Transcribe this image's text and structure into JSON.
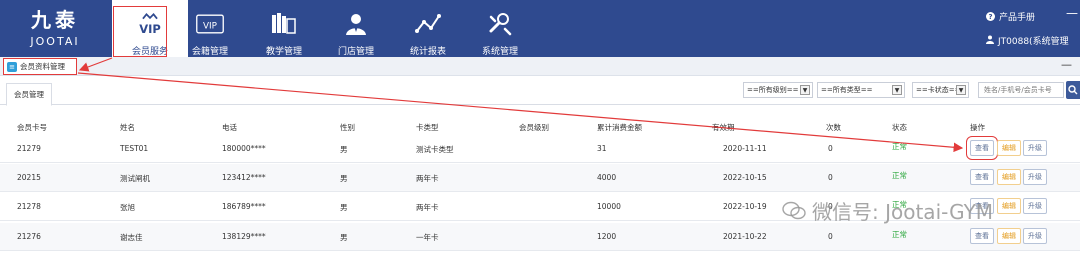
{
  "brand": {
    "cn": "九泰",
    "en": "JOOTAI"
  },
  "nav": [
    {
      "label": "会员服务",
      "icon": "vip-crown-icon",
      "vip_text": "VIP",
      "active": true
    },
    {
      "label": "会籍管理",
      "icon": "vip-card-icon",
      "vip_text": "VIP",
      "active": false
    },
    {
      "label": "教学管理",
      "icon": "books-icon",
      "active": false
    },
    {
      "label": "门店管理",
      "icon": "user-badge-icon",
      "active": false
    },
    {
      "label": "统计报表",
      "icon": "chart-line-icon",
      "active": false
    },
    {
      "label": "系统管理",
      "icon": "wrench-icon",
      "active": false
    }
  ],
  "top_right": {
    "manual": "产品手册",
    "user": "JT0088(系统管理",
    "dash": "—"
  },
  "breadcrumb": {
    "label": "会员资料管理",
    "collapse": "—"
  },
  "tabs": [
    {
      "label": "会员管理"
    }
  ],
  "filters": {
    "level": "==所有级别==",
    "type": "==所有类型==",
    "status": "==卡状态==",
    "search_placeholder": "姓名/手机号/会员卡号"
  },
  "table": {
    "headers": [
      "会员卡号",
      "姓名",
      "电话",
      "性别",
      "卡类型",
      "会员级别",
      "累计消费金额",
      "有效期",
      "次数",
      "状态",
      "操作"
    ],
    "rows": [
      {
        "card": "21279",
        "name": "TEST01",
        "phone": "180000****",
        "gender": "男",
        "card_type": "测试卡类型",
        "level": "",
        "total": "31",
        "expiry": "2020-11-11",
        "count": "0",
        "status": "正常"
      },
      {
        "card": "20215",
        "name": "测试闸机",
        "phone": "123412****",
        "gender": "男",
        "card_type": "两年卡",
        "level": "",
        "total": "4000",
        "expiry": "2022-10-15",
        "count": "0",
        "status": "正常"
      },
      {
        "card": "21278",
        "name": "张旭",
        "phone": "186789****",
        "gender": "男",
        "card_type": "两年卡",
        "level": "",
        "total": "10000",
        "expiry": "2022-10-19",
        "count": "0",
        "status": "正常"
      },
      {
        "card": "21276",
        "name": "谢志佳",
        "phone": "138129****",
        "gender": "男",
        "card_type": "一年卡",
        "level": "",
        "total": "1200",
        "expiry": "2021-10-22",
        "count": "0",
        "status": "正常"
      }
    ],
    "actions": {
      "view": "查看",
      "edit": "编辑",
      "upgrade": "升级"
    }
  },
  "watermark": "微信号: Jootai-GYM",
  "colors": {
    "nav_bg": "#2f4a8f",
    "annotation": "#e23b3b",
    "status_ok": "#2aa63b",
    "edit": "#e39a1a"
  }
}
